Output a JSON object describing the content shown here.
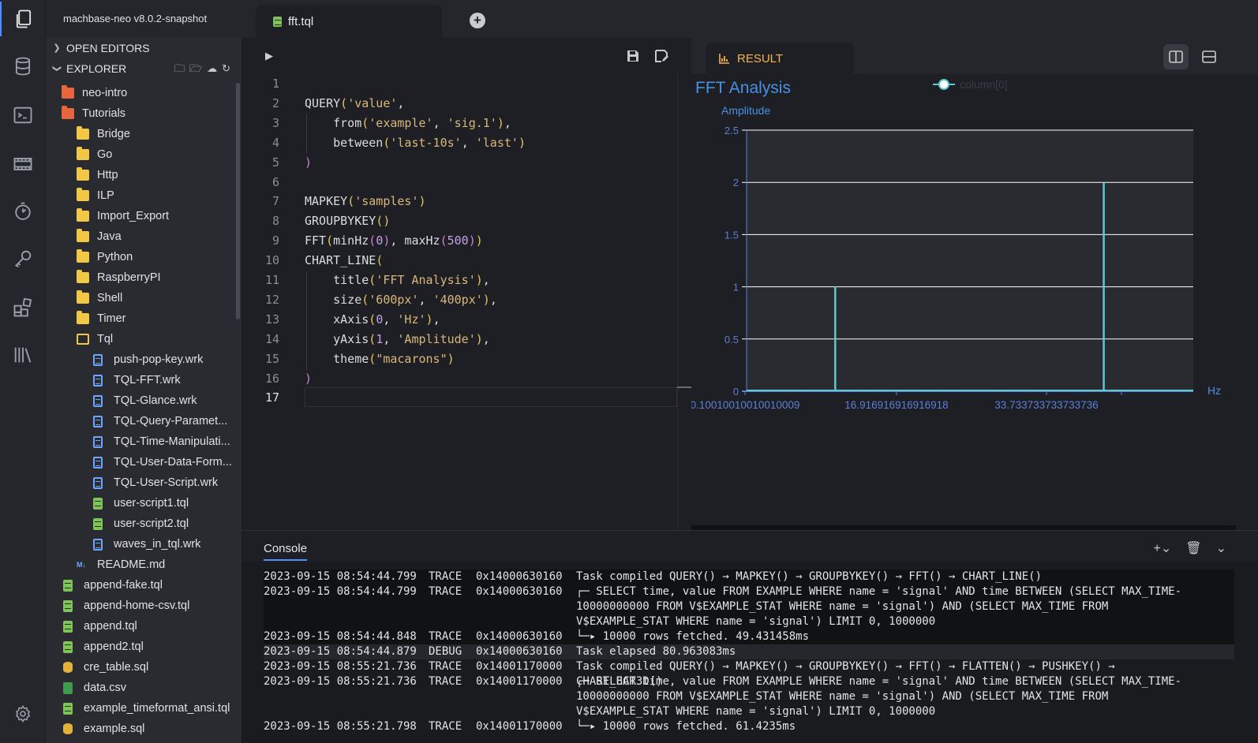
{
  "app": {
    "title": "machbase-neo v8.0.2-snapshot"
  },
  "activity": [
    {
      "icon": "files-icon"
    },
    {
      "icon": "database-icon"
    },
    {
      "icon": "terminal-icon"
    },
    {
      "icon": "film-icon"
    },
    {
      "icon": "timer-icon"
    },
    {
      "icon": "key-icon"
    },
    {
      "icon": "extensions-icon"
    },
    {
      "icon": "library-icon"
    },
    {
      "icon": "gear-icon"
    }
  ],
  "sidebar": {
    "open_editors": "OPEN EDITORS",
    "explorer": "EXPLORER",
    "tree": [
      {
        "label": "neo-intro",
        "type": "special",
        "indent": 0
      },
      {
        "label": "Tutorials",
        "type": "special",
        "indent": 0
      },
      {
        "label": "Bridge",
        "type": "folder",
        "indent": 1
      },
      {
        "label": "Go",
        "type": "folder",
        "indent": 1
      },
      {
        "label": "Http",
        "type": "folder",
        "indent": 1
      },
      {
        "label": "ILP",
        "type": "folder",
        "indent": 1
      },
      {
        "label": "Import_Export",
        "type": "folder",
        "indent": 1
      },
      {
        "label": "Java",
        "type": "folder",
        "indent": 1
      },
      {
        "label": "Python",
        "type": "folder",
        "indent": 1
      },
      {
        "label": "RaspberryPI",
        "type": "folder",
        "indent": 1
      },
      {
        "label": "Shell",
        "type": "folder",
        "indent": 1
      },
      {
        "label": "Timer",
        "type": "folder",
        "indent": 1
      },
      {
        "label": "Tql",
        "type": "open",
        "indent": 1
      },
      {
        "label": "push-pop-key.wrk",
        "type": "wrk",
        "indent": 2
      },
      {
        "label": "TQL-FFT.wrk",
        "type": "wrk",
        "indent": 2
      },
      {
        "label": "TQL-Glance.wrk",
        "type": "wrk",
        "indent": 2
      },
      {
        "label": "TQL-Query-Paramet...",
        "type": "wrk",
        "indent": 2
      },
      {
        "label": "TQL-Time-Manipulati...",
        "type": "wrk",
        "indent": 2
      },
      {
        "label": "TQL-User-Data-Form...",
        "type": "wrk",
        "indent": 2
      },
      {
        "label": "TQL-User-Script.wrk",
        "type": "wrk",
        "indent": 2
      },
      {
        "label": "user-script1.tql",
        "type": "tql",
        "indent": 2
      },
      {
        "label": "user-script2.tql",
        "type": "tql",
        "indent": 2
      },
      {
        "label": "waves_in_tql.wrk",
        "type": "wrk",
        "indent": 2
      },
      {
        "label": "README.md",
        "type": "md",
        "indent": 1
      },
      {
        "label": "append-fake.tql",
        "type": "tql",
        "indent": 0
      },
      {
        "label": "append-home-csv.tql",
        "type": "tql",
        "indent": 0
      },
      {
        "label": "append.tql",
        "type": "tql",
        "indent": 0
      },
      {
        "label": "append2.tql",
        "type": "tql",
        "indent": 0
      },
      {
        "label": "cre_table.sql",
        "type": "sql",
        "indent": 0
      },
      {
        "label": "data.csv",
        "type": "csv",
        "indent": 0
      },
      {
        "label": "example_timeformat_ansi.tql",
        "type": "tql",
        "indent": 0
      },
      {
        "label": "example.sql",
        "type": "sql",
        "indent": 0
      }
    ]
  },
  "tabs": [
    {
      "label": "fft.tql",
      "add_label": "+"
    }
  ],
  "editor": {
    "lines": [
      "",
      "QUERY('value',",
      "    from('example', 'sig.1'),",
      "    between('last-10s', 'last')",
      ")",
      "",
      "MAPKEY('samples')",
      "GROUPBYKEY()",
      "FFT(minHz(0), maxHz(500))",
      "CHART_LINE(",
      "    title('FFT Analysis'),",
      "    size('600px', '400px'),",
      "    xAxis(0, 'Hz'),",
      "    yAxis(1, 'Amplitude'),",
      "    theme(\"macarons\")",
      ")",
      ""
    ],
    "current_line": 17
  },
  "result": {
    "tab_label": "RESULT"
  },
  "chart_data": {
    "type": "line",
    "title": "FFT Analysis",
    "ylabel": "Amplitude",
    "xlabel": "Hz",
    "series": [
      {
        "name": "column[0]",
        "color": "#5ec9cf"
      }
    ],
    "x_tick_labels": [
      "0.10010010010010009",
      "16.916916916916918",
      "33.733733733733736"
    ],
    "y_ticks": [
      0,
      0.5,
      1,
      1.5,
      2,
      2.5
    ],
    "ylim": [
      0,
      2.5
    ],
    "xlim": [
      0.1,
      50
    ],
    "peaks": [
      {
        "x": 10,
        "y": 1
      },
      {
        "x": 40,
        "y": 2
      }
    ],
    "colors": {
      "axis": "#5b7fd6",
      "grid": "#ffffff",
      "plot_bg": "#2a2b30",
      "line": "#5ec9cf",
      "title": "#4a90e2"
    }
  },
  "console": {
    "title": "Console",
    "logs": [
      {
        "time": "2023-09-15 08:54:44.799",
        "level": "TRACE",
        "id": "0x14000630160",
        "msg": "Task compiled QUERY() → MAPKEY() → GROUPBYKEY() → FFT() → CHART_LINE()",
        "style": "hl",
        "lines": 1
      },
      {
        "time": "2023-09-15 08:54:44.799",
        "level": "TRACE",
        "id": "0x14000630160",
        "msg": "┌─ SELECT time, value FROM EXAMPLE WHERE name = 'signal' AND time BETWEEN (SELECT MAX_TIME-10000000000 FROM V$EXAMPLE_STAT WHERE name = 'signal') AND (SELECT MAX_TIME FROM V$EXAMPLE_STAT WHERE name = 'signal') LIMIT 0, 1000000",
        "style": "hl",
        "lines": 3
      },
      {
        "time": "2023-09-15 08:54:44.848",
        "level": "TRACE",
        "id": "0x14000630160",
        "msg": "└─▸ 10000 rows fetched. 49.431458ms",
        "style": "hl",
        "lines": 1
      },
      {
        "time": "2023-09-15 08:54:44.879",
        "level": "DEBUG",
        "id": "0x14000630160",
        "msg": "Task elapsed 80.963083ms",
        "style": "alt",
        "lines": 1
      },
      {
        "time": "2023-09-15 08:55:21.736",
        "level": "TRACE",
        "id": "0x14001170000",
        "msg": "Task compiled QUERY() → MAPKEY() → GROUPBYKEY() → FFT() → FLATTEN() → PUSHKEY() → CHART_BAR3D()",
        "style": "plain",
        "lines": 1
      },
      {
        "time": "2023-09-15 08:55:21.736",
        "level": "TRACE",
        "id": "0x14001170000",
        "msg": "┌─ SELECT time, value FROM EXAMPLE WHERE name = 'signal' AND time BETWEEN (SELECT MAX_TIME-10000000000 FROM V$EXAMPLE_STAT WHERE name = 'signal') AND (SELECT MAX_TIME FROM V$EXAMPLE_STAT WHERE name = 'signal') LIMIT 0, 1000000",
        "style": "plain",
        "lines": 3
      },
      {
        "time": "2023-09-15 08:55:21.798",
        "level": "TRACE",
        "id": "0x14001170000",
        "msg": "└─▸ 10000 rows fetched. 61.4235ms",
        "style": "plain",
        "lines": 1
      }
    ]
  }
}
